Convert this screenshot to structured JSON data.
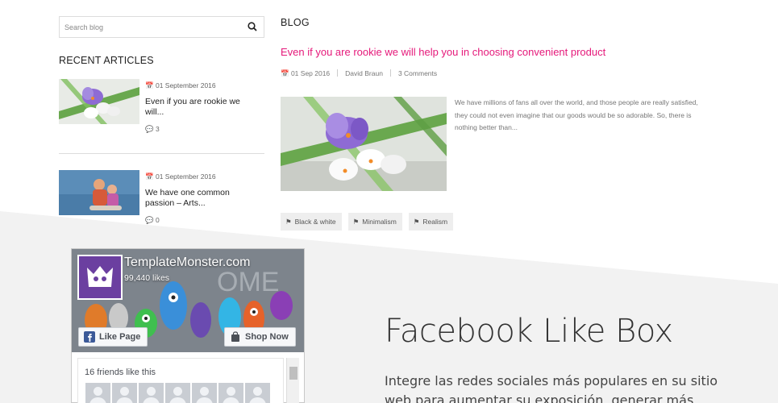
{
  "search": {
    "placeholder": "Search blog",
    "icon": "search-icon"
  },
  "recent": {
    "title": "RECENT ARTICLES",
    "articles": [
      {
        "date": "01 September 2016",
        "title": "Even if you are rookie we will...",
        "comments": "3"
      },
      {
        "date": "01 September 2016",
        "title": "We have one common passion – Arts...",
        "comments": "0"
      }
    ]
  },
  "blog": {
    "heading": "BLOG",
    "post": {
      "title": "Even if you are rookie we will help you in choosing convenient product",
      "date": "01 Sep 2016",
      "author": "David Braun",
      "comments": "3 Comments",
      "excerpt": "We have millions of fans all over the world, and those people are really satisfied, they could not even imagine that our goods would be so adorable. So, there is nothing better than...",
      "tags": [
        "Black & white",
        "Minimalism",
        "Realism"
      ]
    }
  },
  "facebook": {
    "page_name": "TemplateMonster.com",
    "likes": "99,440 likes",
    "like_button": "Like Page",
    "shop_button": "Shop Now",
    "friends_label": "16 friends like this",
    "brand_color": "#3b5998"
  },
  "section": {
    "title": "Facebook Like Box",
    "text": "Integre las redes sociales más populares en su sitio web para aumentar su exposición, generar más"
  },
  "colors": {
    "accent": "#e5197a",
    "band": "#f2f2f2"
  }
}
